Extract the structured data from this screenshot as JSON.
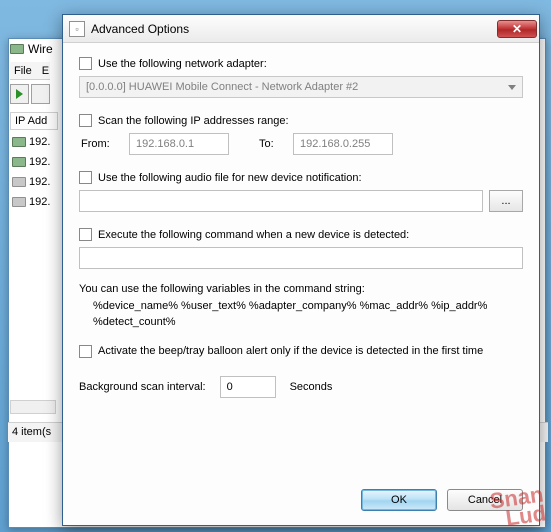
{
  "bg_window": {
    "title_prefix": "Wire",
    "menu": {
      "file": "File",
      "edit_initial": "E"
    },
    "column_header": "IP Add",
    "rows": [
      "192.",
      "192.",
      "192.",
      "192."
    ],
    "status": "4 item(s"
  },
  "dialog": {
    "title": "Advanced Options",
    "adapter": {
      "checkbox_label": "Use the following network adapter:",
      "combo_text": "[0.0.0.0]  HUAWEI Mobile Connect - Network Adapter #2"
    },
    "scan_range": {
      "checkbox_label": "Scan the following IP addresses range:",
      "from_label": "From:",
      "from_value": "192.168.0.1",
      "to_label": "To:",
      "to_value": "192.168.0.255"
    },
    "audio": {
      "checkbox_label": "Use the following audio file for new device notification:",
      "file_value": "",
      "browse_label": "..."
    },
    "command": {
      "checkbox_label": "Execute the following command when a new device is detected:",
      "value": "",
      "info_line": "You can use the following variables in the command string:",
      "vars_line1": "%device_name%  %user_text%  %adapter_company%  %mac_addr%  %ip_addr%",
      "vars_line2": "%detect_count%"
    },
    "beep": {
      "checkbox_label": "Activate the beep/tray balloon alert only if the device is detected in the first time"
    },
    "interval": {
      "label": "Background scan interval:",
      "value": "0",
      "unit": "Seconds"
    },
    "buttons": {
      "ok": "OK",
      "cancel": "Cancel"
    }
  },
  "watermark": {
    "line1": "Snan",
    "line2": "Lud"
  }
}
